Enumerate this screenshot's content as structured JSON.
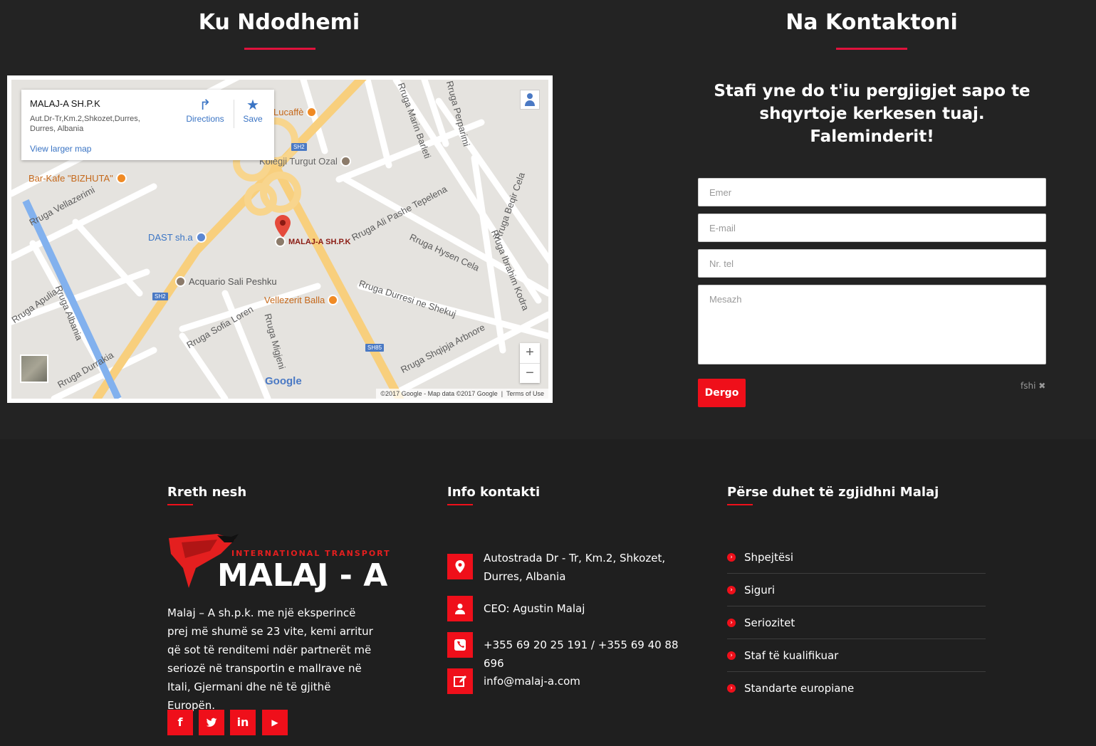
{
  "location": {
    "title": "Ku Ndodhemi",
    "map": {
      "place_name": "MALAJ-A SH.P.K",
      "address": "Aut.Dr-Tr,Km.2,Shkozet,Durres, Durres, Albania",
      "directions_label": "Directions",
      "save_label": "Save",
      "larger_map_label": "View larger map",
      "marker_label": "MALAJ-A SH.P.K",
      "pois": [
        "Lucaffè",
        "Kolegji Turgut Ozal",
        "Bar-Kafe \"BIZHUTA\"",
        "DAST sh.a",
        "Acquario Sali Peshku",
        "Vellezerit Balla"
      ],
      "streets": [
        "Rruga Marin Barleti",
        "Rruga Perparimi",
        "Rruga Vellazerimi",
        "Rruga Ali Pashe Tepelena",
        "Rruga Beqir Cela",
        "Rruga Hysen Cela",
        "Rruga Ibrahim Kodra",
        "Rruga Durresi ne Shekuj",
        "Rruga Apulia",
        "Rruga Albania",
        "Rruga Sofia Loren",
        "Rruga Migjeni",
        "Rruga Shqipja Arbnore",
        "Rruga Durrakia"
      ],
      "shields": [
        "SH2",
        "SH2",
        "SH85"
      ],
      "google_logo": "Google",
      "attribution": "©2017 Google - Map data ©2017 Google",
      "terms": "Terms of Use"
    }
  },
  "contact": {
    "title": "Na Kontaktoni",
    "lead": "Stafi yne do t'iu pergjigjet sapo te shqyrtoje kerkesen tuaj. Faleminderit!",
    "fields": {
      "name_placeholder": "Emer",
      "email_placeholder": "E-mail",
      "phone_placeholder": "Nr. tel",
      "message_placeholder": "Mesazh"
    },
    "send_label": "Dergo",
    "clear_label": "fshi ✖"
  },
  "footer": {
    "about": {
      "heading": "Rreth nesh",
      "logo_sub": "INTERNATIONAL TRANSPORT",
      "logo_main": "MALAJ - A",
      "text": "Malaj – A sh.p.k. me një eksperincë prej më shumë se 23 vite, kemi arritur që sot të renditemi ndër partnerët më seriozë në transportin e mallrave në Itali, Gjermani dhe në të gjithë Europën.",
      "social": [
        "facebook-icon",
        "twitter-icon",
        "linkedin-icon",
        "youtube-icon"
      ]
    },
    "info": {
      "heading": "Info kontakti",
      "address": "Autostrada Dr - Tr, Km.2, Shkozet, Durres, Albania",
      "ceo": "CEO: Agustin Malaj",
      "phone": "+355 69 20 25 191 / +355 69 40 88 696",
      "email": "info@malaj-a.com"
    },
    "why": {
      "heading": "Përse duhet të zgjidhni Malaj",
      "items": [
        "Shpejtësi",
        "Siguri",
        "Seriozitet",
        "Staf të kualifikuar",
        "Standarte europiane"
      ]
    }
  },
  "colors": {
    "accent": "#ef0f1a",
    "background": "#232323",
    "footer": "#1f1f1f"
  }
}
